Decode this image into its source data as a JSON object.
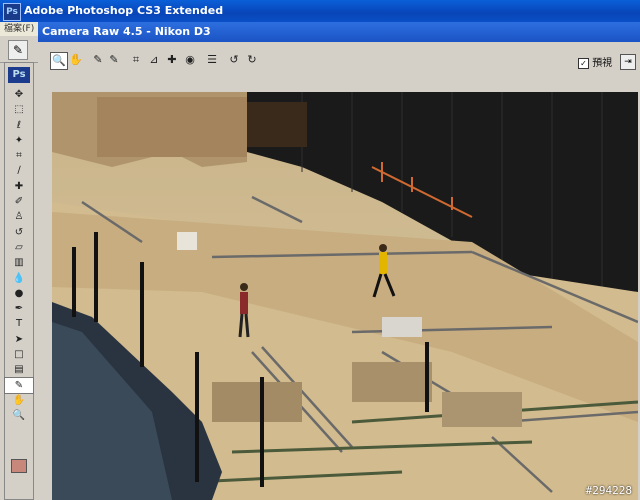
{
  "window": {
    "title": "Adobe Photoshop CS3 Extended",
    "app_icon": "Ps"
  },
  "menubar": {
    "first_menu": "檔案(F)"
  },
  "toolbox": {
    "logo": "Ps"
  },
  "dialog": {
    "title": "Camera Raw 4.5  -  Nikon D3"
  },
  "preview": {
    "label": "預視",
    "checked": true
  },
  "watermark": "#294228",
  "colors": {
    "foreground_swatch": "#c7877a",
    "title_blue": "#1b53c4"
  }
}
